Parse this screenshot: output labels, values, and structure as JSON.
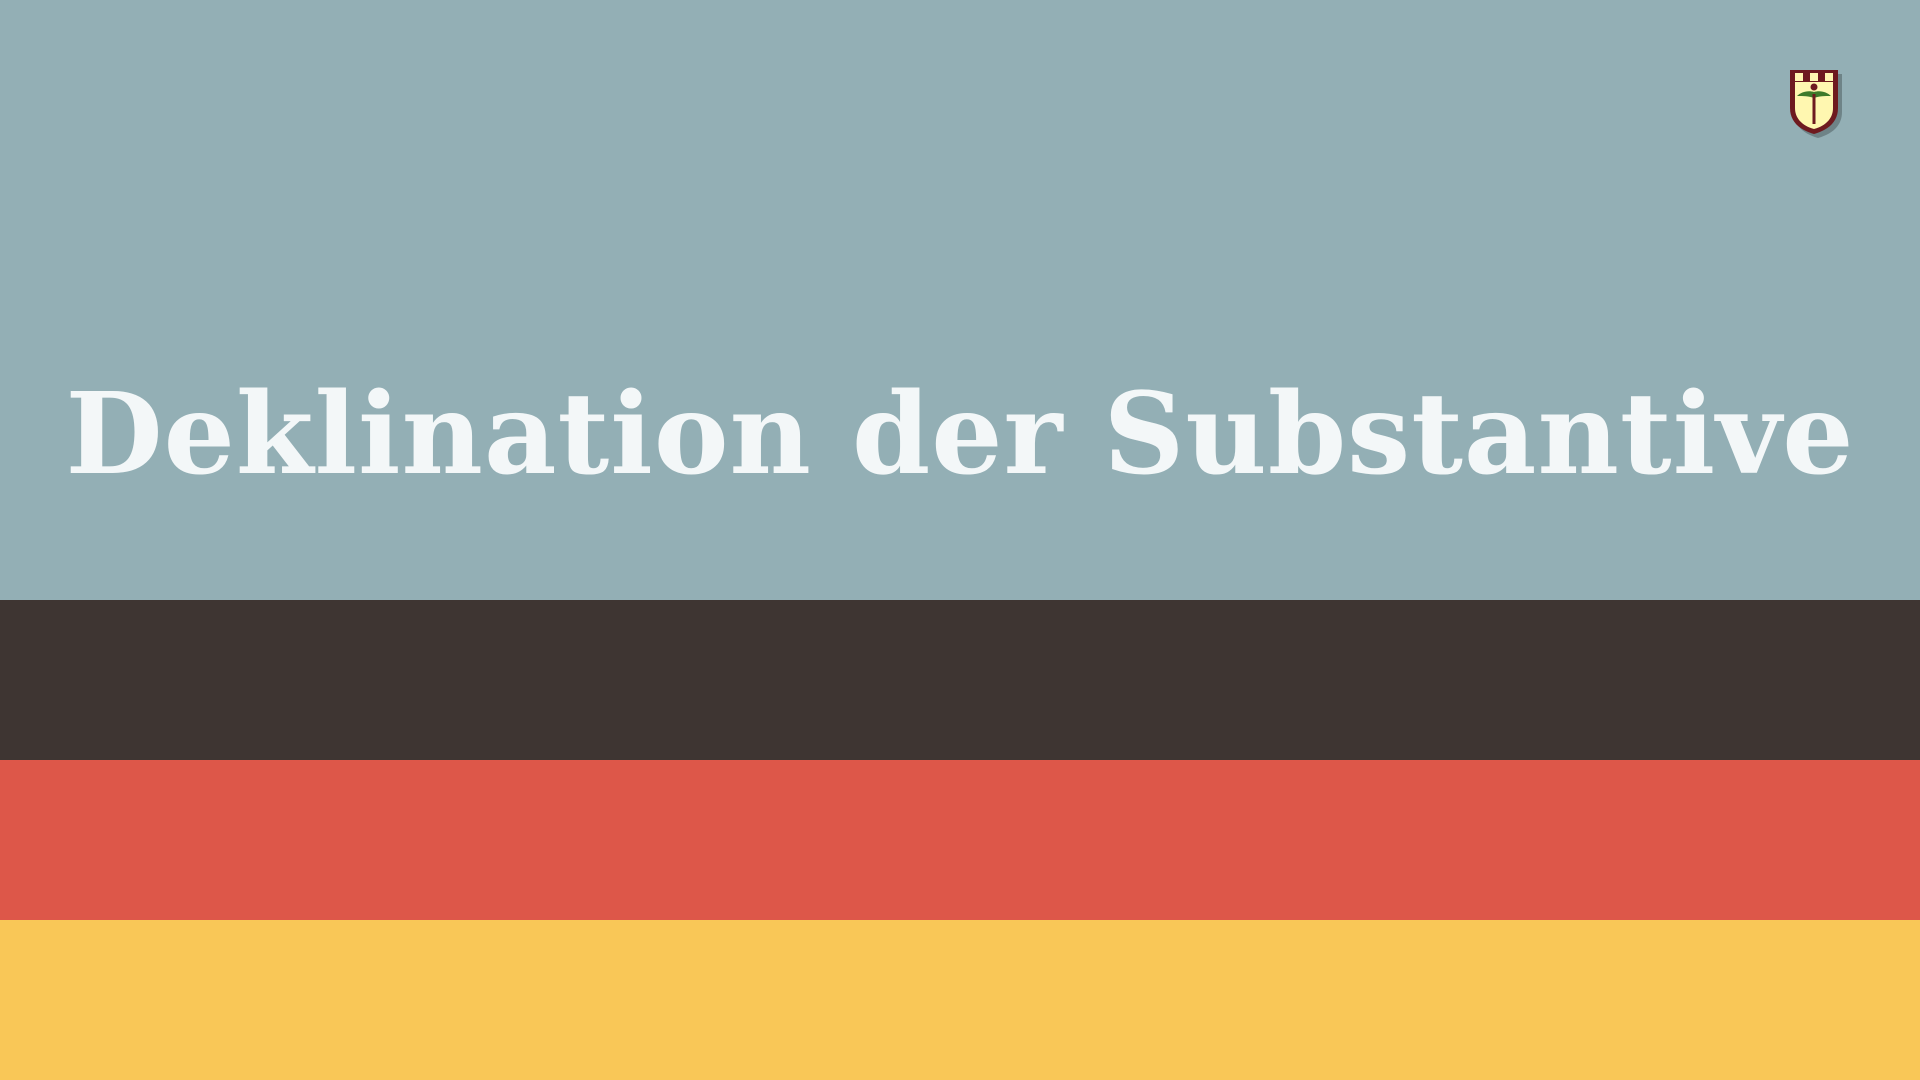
{
  "slide": {
    "title": "Deklination der Substantive"
  },
  "colors": {
    "top_band": "#93AFB5",
    "black_band": "#3E3532",
    "red_band": "#DD5749",
    "gold_band": "#F9C757",
    "title_text": "#F3F7F8",
    "logo_border": "#6E1A1F",
    "logo_fill": "#FFF7B0",
    "logo_accent": "#3E7A2A"
  },
  "icons": {
    "logo": "shield-logo-icon"
  }
}
